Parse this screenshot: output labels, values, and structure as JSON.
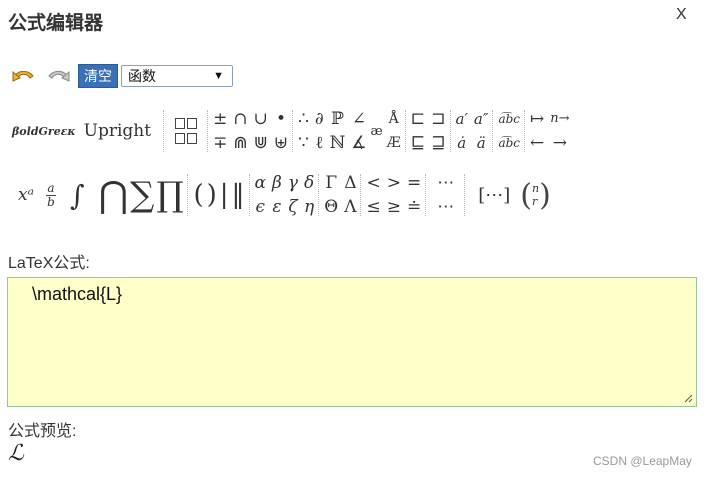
{
  "dialog": {
    "title": "公式编辑器",
    "close_label": "X"
  },
  "toolbar": {
    "undo_icon": "undo-icon",
    "redo_icon": "redo-icon",
    "clear_label": "清空",
    "select_value": "函数",
    "select_chevron": "⌄"
  },
  "symbols_row1": {
    "bold_greek": "βoldGreεκ",
    "upright": "Upright",
    "ops_grid": [
      "±",
      "∩",
      "∪",
      "•",
      "∓",
      "⋒",
      "⋓",
      "⊎"
    ],
    "misc_grid": [
      "∴",
      "∂",
      "ℙ",
      "∠",
      "∵",
      "ℓ",
      "ℕ",
      "∡"
    ],
    "ae": "æ",
    "accent_grid": [
      "Å",
      "Æ"
    ],
    "set_grid": [
      "⊏",
      "⊐",
      "⊑",
      "⊒"
    ],
    "prime_grid": [
      "a′",
      "a″",
      "ȧ",
      "ä"
    ],
    "wide_grid": [
      "a͡bc",
      "a͡bc"
    ],
    "arrow_grid": [
      "↦",
      "n→",
      "←",
      "→"
    ]
  },
  "symbols_row2": {
    "power": "xᵃ",
    "frac_num": "a",
    "frac_den": "b",
    "integral": "∫",
    "bigcap": "⋂",
    "sum": "∑",
    "prod": "∏",
    "delims": [
      "(",
      ")",
      "|",
      "‖"
    ],
    "greek_lower": [
      "α",
      "β",
      "γ",
      "δ",
      "ϵ",
      "ε",
      "ζ",
      "η"
    ],
    "greek_upper": [
      "Γ",
      "Δ",
      "Θ",
      "Λ"
    ],
    "relations": [
      "<",
      ">",
      "=",
      "≤",
      "≥",
      "≐"
    ],
    "dots": [
      "⋯",
      "⋯"
    ],
    "matrix": "[⋯]",
    "binom_top": "n",
    "binom_bottom": "r"
  },
  "latex": {
    "label": "LaTeX公式:",
    "value": "\\mathcal{L}"
  },
  "preview": {
    "label": "公式预览:",
    "value": "ℒ"
  },
  "credit": "CSDN @LeapMay"
}
